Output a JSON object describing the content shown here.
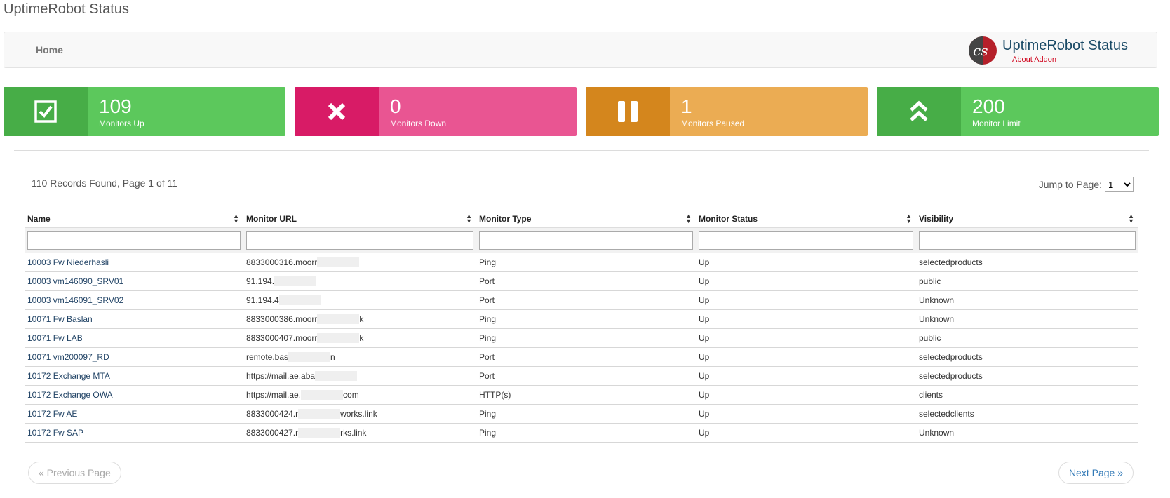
{
  "page": {
    "title": "UptimeRobot Status"
  },
  "nav": {
    "home": "Home",
    "brand_name": "UptimeRobot Status",
    "brand_sub": "About Addon",
    "logo_text": "cs"
  },
  "stats": [
    {
      "value": "109",
      "label": "Monitors Up",
      "icon": "checkbox-icon"
    },
    {
      "value": "0",
      "label": "Monitors Down",
      "icon": "x-icon"
    },
    {
      "value": "1",
      "label": "Monitors Paused",
      "icon": "pause-icon"
    },
    {
      "value": "200",
      "label": "Monitor Limit",
      "icon": "double-chevron-up-icon"
    }
  ],
  "records": {
    "summary": "110 Records Found, Page 1 of 11",
    "jump_label": "Jump to Page:",
    "jump_value": "1"
  },
  "table": {
    "headers": [
      "Name",
      "Monitor URL",
      "Monitor Type",
      "Monitor Status",
      "Visibility"
    ],
    "rows": [
      {
        "name": "10003 Fw Niederhasli",
        "url_a": "8833000316.moorr",
        "url_b": "",
        "type": "Ping",
        "status": "Up",
        "visibility": "selectedproducts"
      },
      {
        "name": "10003 vm146090_SRV01",
        "url_a": "91.194.",
        "url_b": "",
        "type": "Port",
        "status": "Up",
        "visibility": "public"
      },
      {
        "name": "10003 vm146091_SRV02",
        "url_a": "91.194.4",
        "url_b": "",
        "type": "Port",
        "status": "Up",
        "visibility": "Unknown"
      },
      {
        "name": "10071 Fw Baslan",
        "url_a": "8833000386.moorr",
        "url_b": "k",
        "type": "Ping",
        "status": "Up",
        "visibility": "Unknown"
      },
      {
        "name": "10071 Fw LAB",
        "url_a": "8833000407.moorr",
        "url_b": "k",
        "type": "Ping",
        "status": "Up",
        "visibility": "public"
      },
      {
        "name": "10071 vm200097_RD",
        "url_a": "remote.bas",
        "url_b": "n",
        "type": "Port",
        "status": "Up",
        "visibility": "selectedproducts"
      },
      {
        "name": "10172 Exchange MTA",
        "url_a": "https://mail.ae.aba",
        "url_b": "",
        "type": "Port",
        "status": "Up",
        "visibility": "selectedproducts"
      },
      {
        "name": "10172 Exchange OWA",
        "url_a": "https://mail.ae.",
        "url_b": "com",
        "type": "HTTP(s)",
        "status": "Up",
        "visibility": "clients"
      },
      {
        "name": "10172 Fw AE",
        "url_a": "8833000424.r",
        "url_b": "works.link",
        "type": "Ping",
        "status": "Up",
        "visibility": "selectedclients"
      },
      {
        "name": "10172 Fw SAP",
        "url_a": "8833000427.r",
        "url_b": "rks.link",
        "type": "Ping",
        "status": "Up",
        "visibility": "Unknown"
      }
    ]
  },
  "pagination": {
    "prev": "« Previous Page",
    "next": "Next Page »"
  }
}
